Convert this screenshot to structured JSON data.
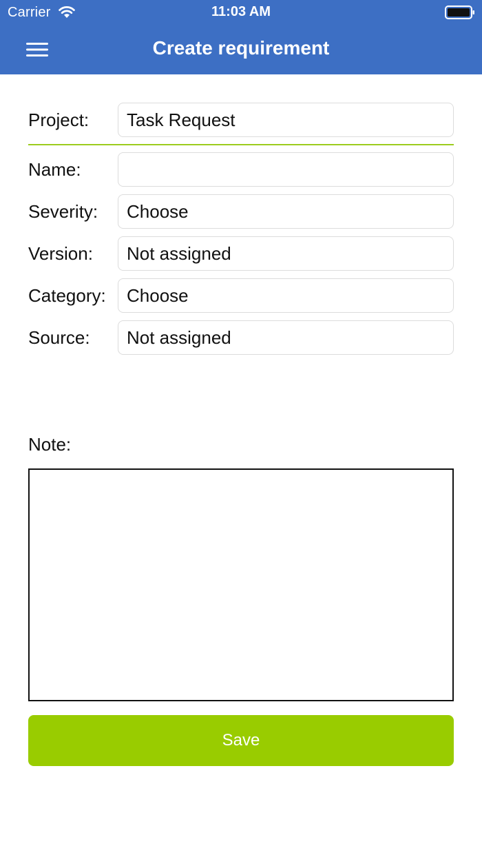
{
  "status_bar": {
    "carrier": "Carrier",
    "time": "11:03 AM",
    "icons": [
      "wifi-icon",
      "battery-icon"
    ]
  },
  "nav": {
    "title": "Create requirement",
    "menu_icon": "hamburger-menu-icon"
  },
  "form": {
    "project": {
      "label": "Project:",
      "value": "Task Request"
    },
    "name": {
      "label": "Name:",
      "value": "",
      "placeholder": ""
    },
    "severity": {
      "label": "Severity:",
      "value": "Choose"
    },
    "version": {
      "label": "Version:",
      "value": "Not assigned"
    },
    "category": {
      "label": "Category:",
      "value": "Choose"
    },
    "source": {
      "label": "Source:",
      "value": "Not assigned"
    },
    "note": {
      "label": "Note:",
      "value": ""
    }
  },
  "actions": {
    "save_label": "Save"
  },
  "colors": {
    "header": "#3d6fc4",
    "accent_green": "#99cc00",
    "divider_green": "#9ccc1e",
    "field_border": "#dcdcdc"
  }
}
